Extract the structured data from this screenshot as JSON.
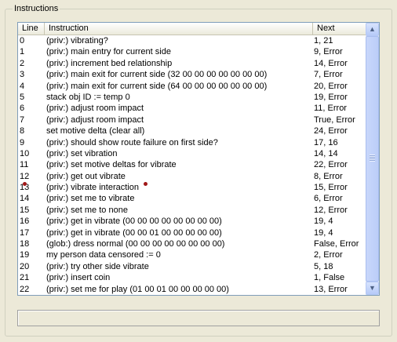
{
  "group": {
    "title": "Instructions"
  },
  "columns": {
    "line": "Line",
    "instruction": "Instruction",
    "next": "Next"
  },
  "rows": [
    {
      "line": "0",
      "instruction": "(priv:) vibrating?",
      "next": "1, 21"
    },
    {
      "line": "1",
      "instruction": "(priv:) main entry for current side",
      "next": "9, Error"
    },
    {
      "line": "2",
      "instruction": "(priv:) increment bed relationship",
      "next": "14, Error"
    },
    {
      "line": "3",
      "instruction": "(priv:) main exit for current side (32 00 00 00 00 00 00 00)",
      "next": "7, Error"
    },
    {
      "line": "4",
      "instruction": "(priv:) main exit for current side (64 00 00 00 00 00 00 00)",
      "next": "20, Error"
    },
    {
      "line": "5",
      "instruction": "stack obj ID := temp 0",
      "next": "19, Error"
    },
    {
      "line": "6",
      "instruction": "(priv:) adjust room impact",
      "next": "11, Error"
    },
    {
      "line": "7",
      "instruction": "(priv:) adjust room impact",
      "next": "True, Error"
    },
    {
      "line": "8",
      "instruction": "set motive delta (clear all)",
      "next": "24, Error"
    },
    {
      "line": "9",
      "instruction": "(priv:) should show route failure on first side?",
      "next": "17, 16"
    },
    {
      "line": "10",
      "instruction": "(priv:) set vibration",
      "next": "14, 14"
    },
    {
      "line": "11",
      "instruction": "(priv:) set motive deltas for vibrate",
      "next": "22, Error"
    },
    {
      "line": "12",
      "instruction": "(priv:) get out vibrate",
      "next": "8, Error"
    },
    {
      "line": "13",
      "instruction": "(priv:) vibrate interaction",
      "next": "15, Error"
    },
    {
      "line": "14",
      "instruction": "(priv:) set me to vibrate",
      "next": "6, Error"
    },
    {
      "line": "15",
      "instruction": "(priv:) set me to none",
      "next": "12, Error"
    },
    {
      "line": "16",
      "instruction": "(priv:) get in vibrate (00 00 00 00 00 00 00 00)",
      "next": "19, 4"
    },
    {
      "line": "17",
      "instruction": "(priv:) get in vibrate (00 00 01 00 00 00 00 00)",
      "next": "19, 4"
    },
    {
      "line": "18",
      "instruction": "(glob:) dress normal (00 00 00 00 00 00 00 00)",
      "next": "False, Error"
    },
    {
      "line": "19",
      "instruction": "my person data censored := 0",
      "next": "2, Error"
    },
    {
      "line": "20",
      "instruction": "(priv:) try other side vibrate",
      "next": "5, 18"
    },
    {
      "line": "21",
      "instruction": "(priv:) insert coin",
      "next": "1, False"
    },
    {
      "line": "22",
      "instruction": "(priv:) set me for play (01 00 01 00 00 00 00 00)",
      "next": "13, Error"
    },
    {
      "line": "23",
      "instruction": "(priv:) set me for play (01 00 00 00 00 00 00 00)",
      "next": "3, Error"
    }
  ],
  "breakpoint_row": "13",
  "status": {
    "text": ""
  },
  "icons": {
    "scroll_up": "arrow-up-icon",
    "scroll_down": "arrow-down-icon"
  },
  "colors": {
    "breakpoint": "#A01818",
    "window_bg": "#ECE9D8"
  }
}
